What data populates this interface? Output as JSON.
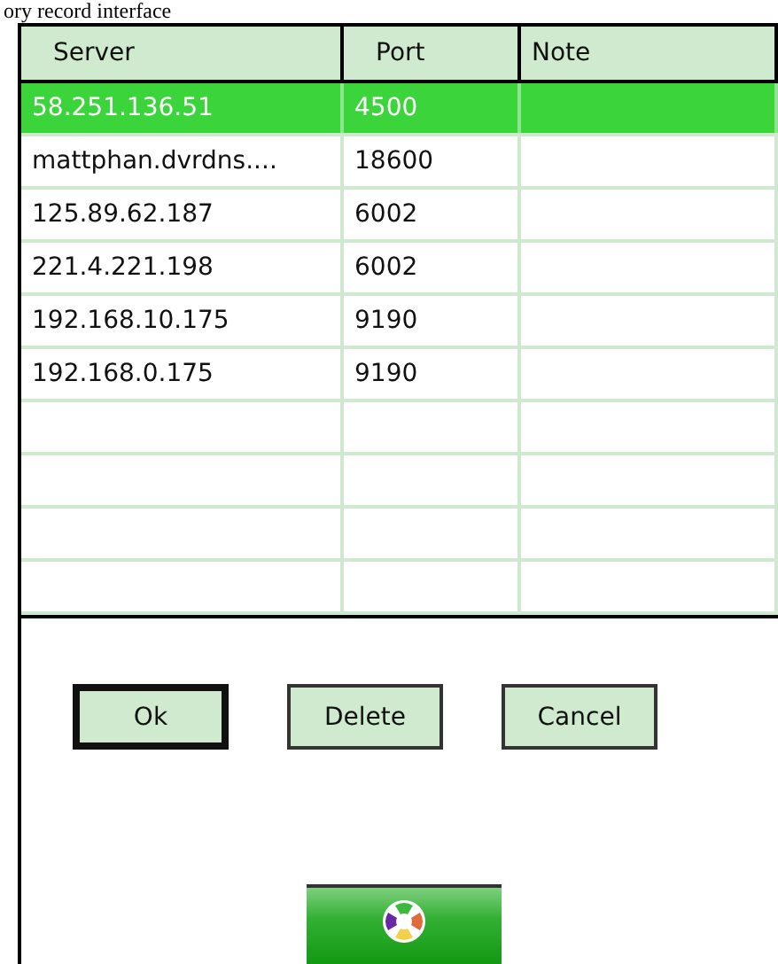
{
  "caption": "ory record interface",
  "table": {
    "columns": [
      "Server",
      "Port",
      "Note"
    ],
    "rows": [
      {
        "server": "58.251.136.51",
        "port": "4500",
        "selected": true
      },
      {
        "server": "mattphan.dvrdns....",
        "port": "18600",
        "selected": false
      },
      {
        "server": "125.89.62.187",
        "port": "6002",
        "selected": false
      },
      {
        "server": "221.4.221.198",
        "port": "6002",
        "selected": false
      },
      {
        "server": "192.168.10.175",
        "port": "9190",
        "selected": false
      },
      {
        "server": "192.168.0.175",
        "port": "9190",
        "selected": false
      }
    ]
  },
  "buttons": [
    {
      "label": "Ok",
      "focused": true
    },
    {
      "label": "Delete",
      "focused": false
    },
    {
      "label": "Cancel",
      "focused": false
    }
  ]
}
